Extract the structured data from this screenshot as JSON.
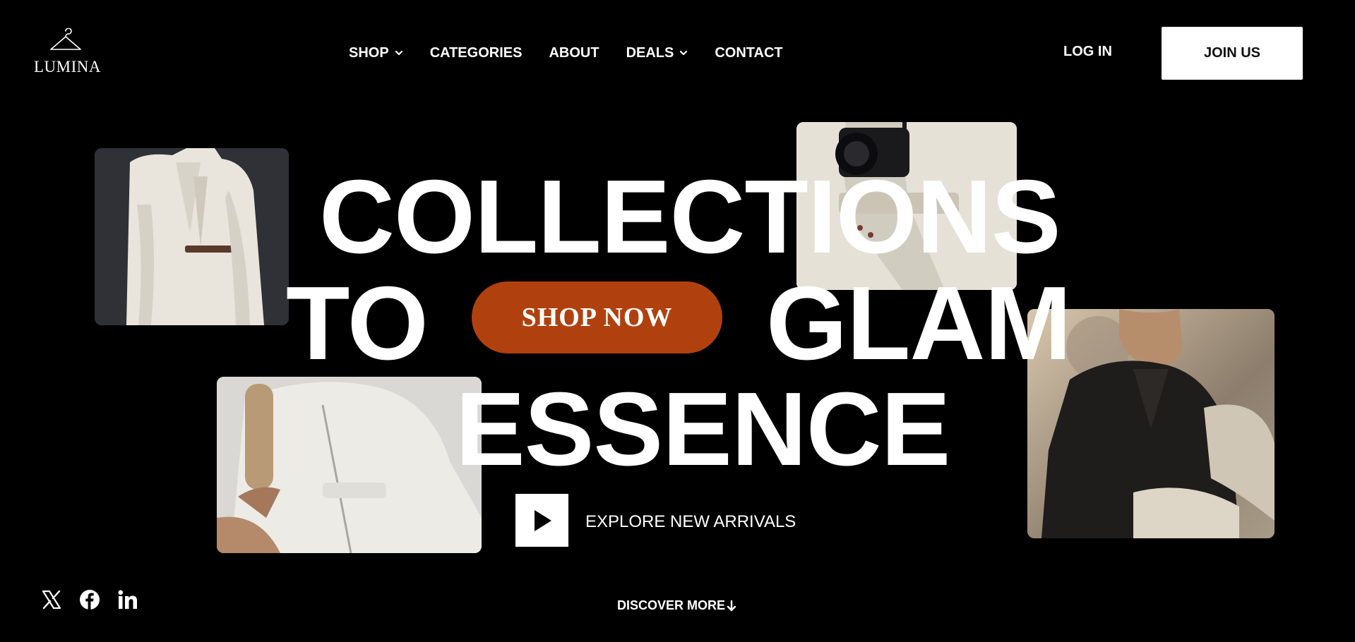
{
  "brand": {
    "name": "LUMINA",
    "logo_icon": "hanger-icon"
  },
  "nav": {
    "items": [
      {
        "label": "SHOP",
        "has_dropdown": true
      },
      {
        "label": "CATEGORIES",
        "has_dropdown": false
      },
      {
        "label": "ABOUT",
        "has_dropdown": false
      },
      {
        "label": "DEALS",
        "has_dropdown": true
      },
      {
        "label": "CONTACT",
        "has_dropdown": false
      }
    ],
    "login_label": "LOG IN",
    "join_label": "JOIN US"
  },
  "hero": {
    "line_1": "COLLECTIONS",
    "line_2_left": "TO",
    "line_2_right": "GLAM",
    "line_3": "ESSENCE",
    "cta_label": "SHOP NOW",
    "explore_label": "EXPLORE NEW ARRIVALS",
    "play_icon": "play-icon"
  },
  "photos": [
    {
      "name": "photo-white-suit"
    },
    {
      "name": "photo-camera-strap"
    },
    {
      "name": "photo-linen-dress"
    },
    {
      "name": "photo-black-shirt"
    }
  ],
  "footer": {
    "socials": [
      "x-icon",
      "facebook-icon",
      "linkedin-icon"
    ],
    "discover_label": "DISCOVER MORE",
    "discover_icon": "arrow-down-icon"
  },
  "colors": {
    "background": "#000000",
    "accent": "#b0410e",
    "text": "#ffffff"
  }
}
